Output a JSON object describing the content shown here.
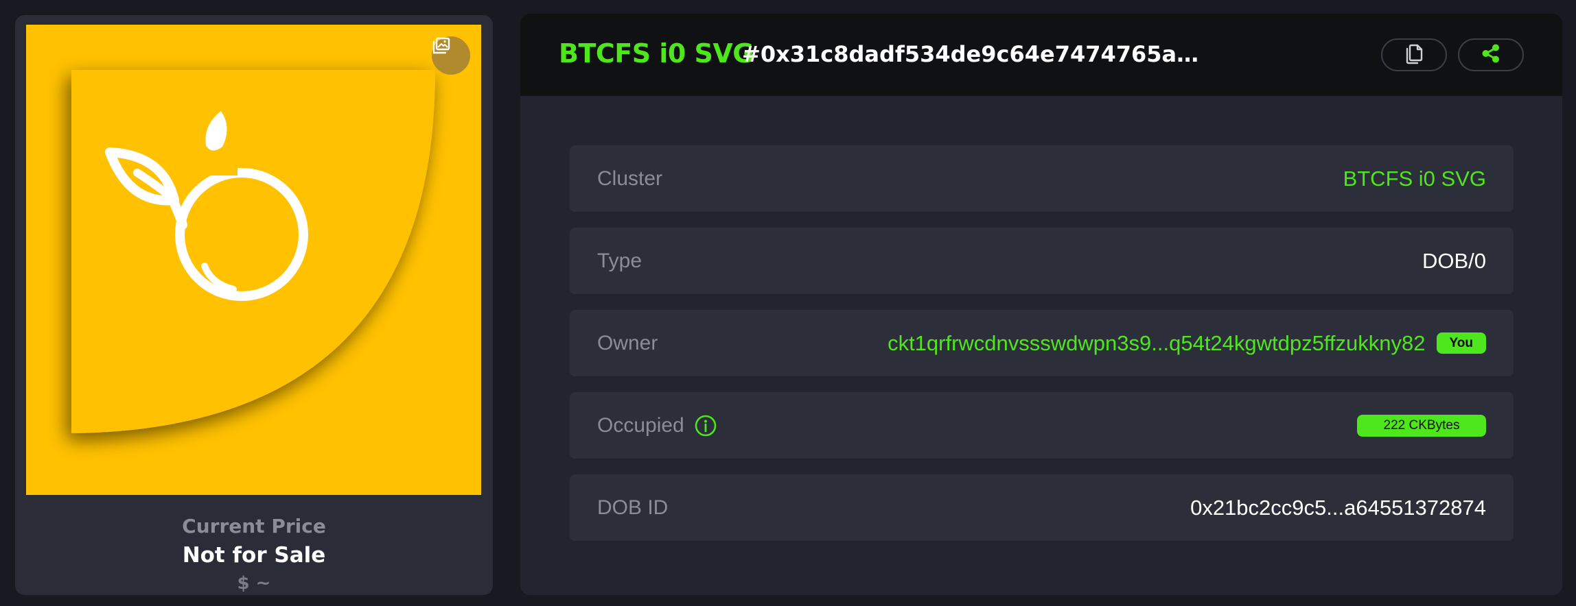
{
  "artwork": {
    "gallery_icon": "gallery-icon",
    "background_color": "#ffc100"
  },
  "price": {
    "label": "Current Price",
    "value": "Not for Sale",
    "usd": "$ ~"
  },
  "header": {
    "cluster_name": "BTCFS i0 SVG",
    "token_id": "#0x31c8dadf534de9c64e7474765a390e63aa0c37ade19c...",
    "copy_icon": "copy-icon",
    "share_icon": "share-icon"
  },
  "details": {
    "cluster": {
      "label": "Cluster",
      "value": "BTCFS i0 SVG"
    },
    "type": {
      "label": "Type",
      "value": "DOB/0"
    },
    "owner": {
      "label": "Owner",
      "value": "ckt1qrfrwcdnvssswdwpn3s9...q54t24kgwtdpz5ffzukkny82",
      "badge": "You"
    },
    "occupied": {
      "label": "Occupied",
      "value": "222 CKBytes",
      "info_icon": "info-icon"
    },
    "dob_id": {
      "label": "DOB ID",
      "value": "0x21bc2cc9c5...a64551372874"
    }
  },
  "colors": {
    "accent": "#4ee61c",
    "page_bg": "#181a22",
    "panel_bg": "#22252f",
    "row_bg": "#2c2f39"
  }
}
